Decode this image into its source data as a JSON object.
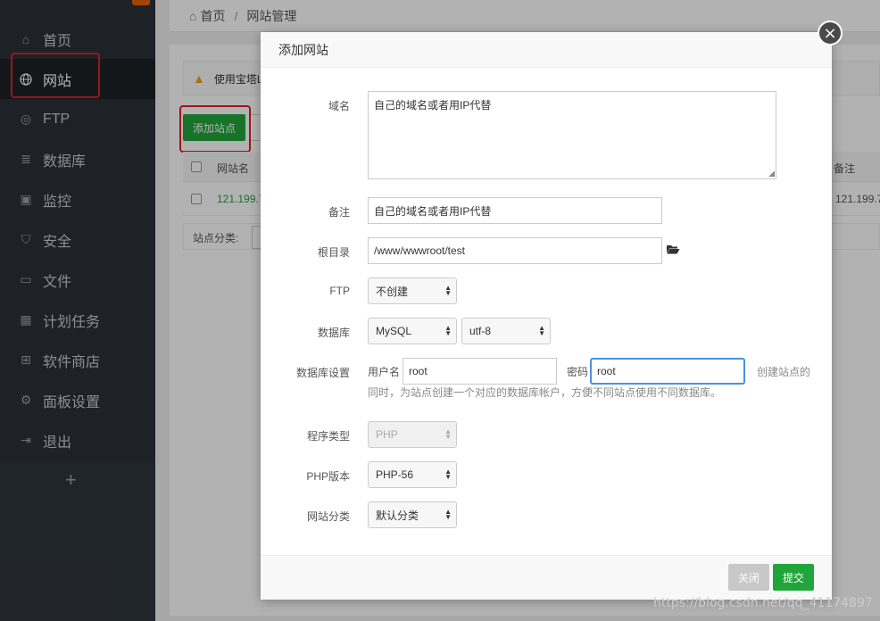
{
  "breadcrumb": {
    "home": "首页",
    "current": "网站管理"
  },
  "sidebar": {
    "items": [
      {
        "label": "首页",
        "icon": "home-icon"
      },
      {
        "label": "网站",
        "icon": "globe-icon"
      },
      {
        "label": "FTP",
        "icon": "ftp-icon"
      },
      {
        "label": "数据库",
        "icon": "database-icon"
      },
      {
        "label": "监控",
        "icon": "monitor-icon"
      },
      {
        "label": "安全",
        "icon": "shield-icon"
      },
      {
        "label": "文件",
        "icon": "folder-icon"
      },
      {
        "label": "计划任务",
        "icon": "calendar-icon"
      },
      {
        "label": "软件商店",
        "icon": "grid-icon"
      },
      {
        "label": "面板设置",
        "icon": "gear-icon"
      },
      {
        "label": "退出",
        "icon": "logout-icon"
      }
    ],
    "add": "+"
  },
  "background": {
    "warning": "使用宝塔L",
    "add_site": "添加站点",
    "col_name": "网站名",
    "col_note": "备注",
    "row_name": "121.199.7",
    "row_note": "121.199.7",
    "category_label": "站点分类:"
  },
  "modal": {
    "title": "添加网站",
    "domain_label": "域名",
    "domain_value": "自己的域名或者用IP代替",
    "note_label": "备注",
    "note_value": "自己的域名或者用IP代替",
    "root_label": "根目录",
    "root_value": "/www/wwwroot/test",
    "ftp_label": "FTP",
    "ftp_value": "不创建",
    "db_label": "数据库",
    "db_type": "MySQL",
    "db_charset": "utf-8",
    "db_settings_label": "数据库设置",
    "db_user_label": "用户名",
    "db_user_value": "root",
    "db_pass_label": "密码",
    "db_pass_value": "root",
    "db_hint_1": "创建站点的",
    "db_hint_2": "同时，为站点创建一个对应的数据库帐户，方便不同站点使用不同数据库。",
    "program_label": "程序类型",
    "program_value": "PHP",
    "php_label": "PHP版本",
    "php_value": "PHP-56",
    "category_label": "网站分类",
    "category_value": "默认分类",
    "close_button": "关闭",
    "submit_button": "提交",
    "close_icon": "×"
  },
  "watermark": "https://blog.csdn.net/qq_41174897",
  "colors": {
    "accent_green": "#20a53a",
    "highlight_red": "#e02020",
    "focus_blue": "#4a90e2"
  }
}
